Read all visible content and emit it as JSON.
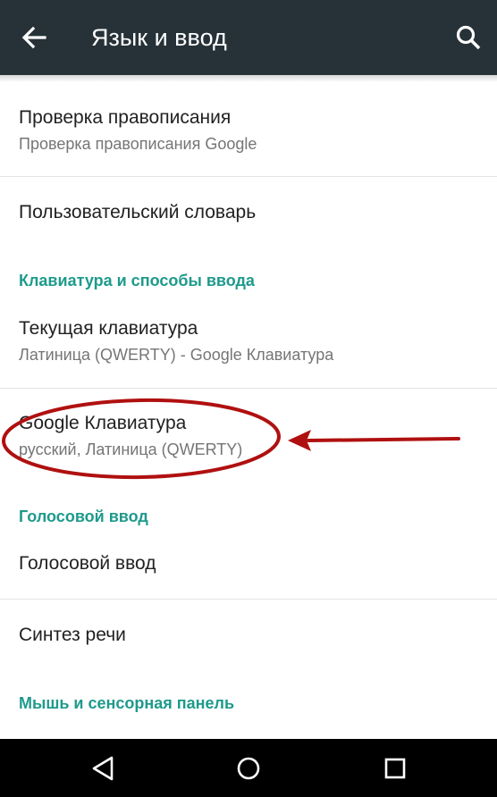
{
  "appbar": {
    "title": "Язык и ввод",
    "back_icon": "arrow-back-icon",
    "search_icon": "search-icon",
    "background_color": "#263238"
  },
  "items": [
    {
      "primary": "Проверка правописания",
      "secondary": "Проверка правописания Google"
    },
    {
      "primary": "Пользовательский словарь"
    },
    {
      "primary": "Текущая клавиатура",
      "secondary": "Латиница (QWERTY) - Google Клавиатура"
    },
    {
      "primary": "Google Клавиатура",
      "secondary": "русский, Латиница (QWERTY)"
    },
    {
      "primary": "Голосовой ввод"
    },
    {
      "primary": "Синтез речи"
    }
  ],
  "sections": {
    "keyboard": "Клавиатура и способы ввода",
    "voice": "Голосовой ввод",
    "mouse": "Мышь и сенсорная панель"
  },
  "annotation": {
    "shape": "ellipse-with-arrow",
    "target": "Google Клавиатура",
    "color": "#b01010"
  },
  "navbar": {
    "back_icon": "nav-back-icon",
    "home_icon": "nav-home-icon",
    "recents_icon": "nav-recents-icon"
  },
  "colors": {
    "accent": "#1e9a8c",
    "primary_text": "#212121",
    "secondary_text": "#757575"
  }
}
